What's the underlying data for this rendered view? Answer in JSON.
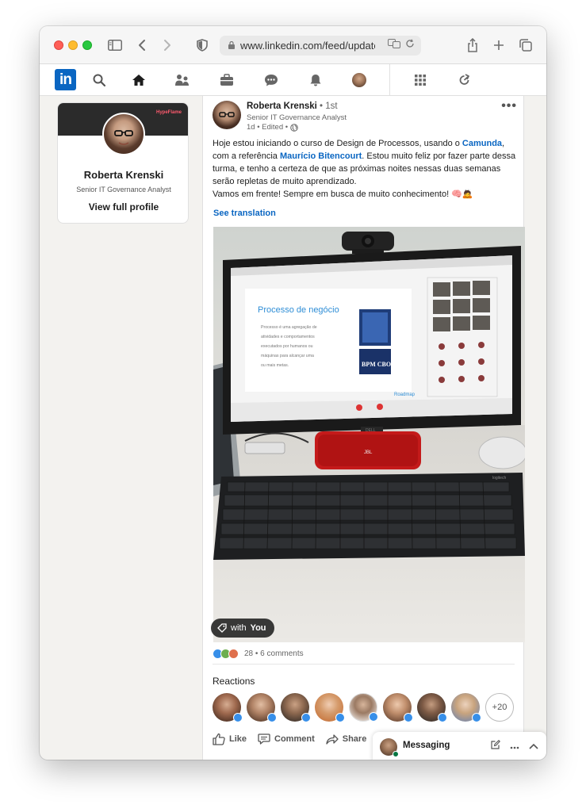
{
  "browser": {
    "url": "www.linkedin.com/feed/update/"
  },
  "profile": {
    "name": "Roberta Krenski",
    "headline": "Senior IT Governance Analyst",
    "view_profile": "View full profile",
    "banner_brand": "HypeFlame"
  },
  "post": {
    "author": "Roberta Krenski",
    "separator": "•",
    "degree": "1st",
    "headline": "Senior IT Governance Analyst",
    "meta": "1d • Edited •",
    "more": "•••",
    "text_part1": "Hoje estou iniciando o curso de Design de Processos, usando o ",
    "link1": "Camunda",
    "text_part2": ", com a referência ",
    "link2": "Maurício Bitencourt",
    "text_part3": ". Estou muito feliz por fazer parte dessa turma, e tenho a certeza de que as próximas noites nessas duas semanas serão repletas de muito aprendizado.",
    "text_line2": "Vamos em frente! Sempre em busca de muito conhecimento! 🧠🙇",
    "see_translation": "See translation",
    "tag_prefix": "with",
    "tag_name": "You",
    "reaction_summary": "28 • 6 comments",
    "reactions_title": "Reactions",
    "more_reactors": "+20",
    "image_content": {
      "slide_title": "Processo de negócio",
      "slide_body": "Processo é uma agregação de atividades e comportamentos executados por humanos ou máquinas para alcançar uma ou mais metas.",
      "book_title": "BPM CBOK",
      "slide_footer": "Roadmap",
      "monitor_brand": "DELL",
      "speaker_brand": "JBL",
      "keyboard_brand": "logitech"
    }
  },
  "actions": {
    "like": "Like",
    "comment": "Comment",
    "share": "Share"
  },
  "messaging": {
    "label": "Messaging"
  },
  "colors": {
    "linkedin_blue": "#0a66c2",
    "feed_bg": "#f3f2ef"
  }
}
